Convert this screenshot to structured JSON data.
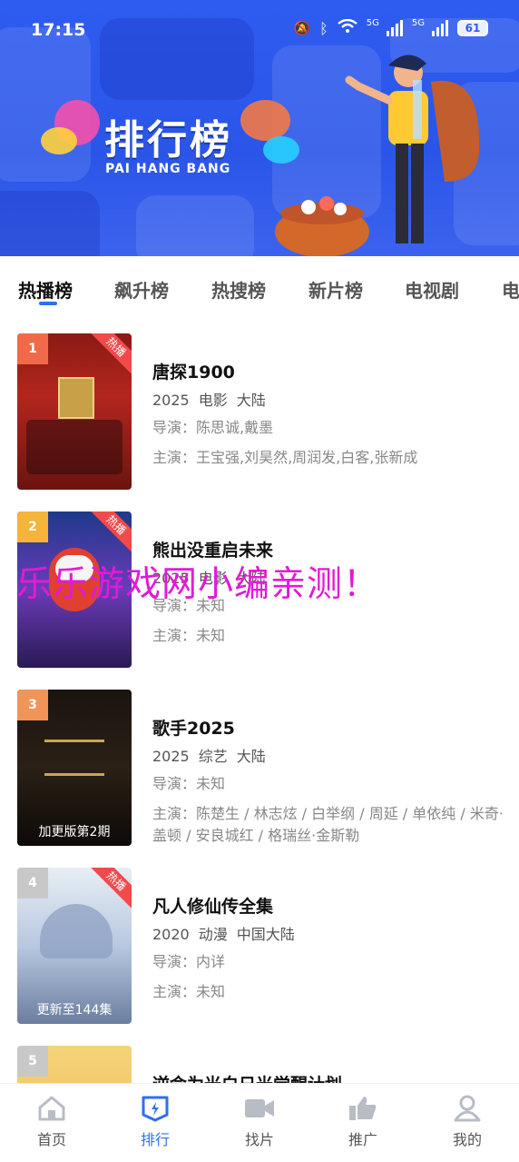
{
  "status_bar": {
    "time": "17:15",
    "network1": "5G",
    "network2": "5G",
    "battery": "61"
  },
  "banner": {
    "title": "排行榜",
    "subtitle": "PAI HANG BANG"
  },
  "tabs": [
    {
      "label": "热播榜",
      "active": true
    },
    {
      "label": "飙升榜"
    },
    {
      "label": "热搜榜"
    },
    {
      "label": "新片榜"
    },
    {
      "label": "电视剧"
    },
    {
      "label": "电"
    }
  ],
  "items": [
    {
      "rank": "1",
      "badge": "热播",
      "title": "唐探1900",
      "year": "2025",
      "genre": "电影",
      "region": "大陆",
      "director": "导演：陈思诚,戴墨",
      "cast": "主演：王宝强,刘昊然,周润发,白客,张新成",
      "overlay": ""
    },
    {
      "rank": "2",
      "badge": "热播",
      "title": "熊出没重启未来",
      "year": "2025",
      "genre": "电影",
      "region": "大陆",
      "director": "导演：未知",
      "cast": "主演：未知",
      "overlay": ""
    },
    {
      "rank": "3",
      "badge": "",
      "title": "歌手2025",
      "year": "2025",
      "genre": "综艺",
      "region": "大陆",
      "director": "导演：未知",
      "cast": "主演：陈楚生 / 林志炫 / 白举纲 / 周延 / 单依纯 / 米奇·盖顿 / 安良城红 / 格瑞丝·金斯勒",
      "overlay": "加更版第2期"
    },
    {
      "rank": "4",
      "badge": "热播",
      "title": "凡人修仙传全集",
      "year": "2020",
      "genre": "动漫",
      "region": "中国大陆",
      "director": "导演：内详",
      "cast": "主演：未知",
      "overlay": "更新至144集"
    },
    {
      "rank": "5",
      "badge": "",
      "title": "逆命为光白日光觉醒计划",
      "year": "",
      "genre": "",
      "region": "",
      "director": "",
      "cast": "",
      "overlay": ""
    }
  ],
  "watermark": "乐乐游戏网小编亲测！",
  "colors": {
    "accent": "#2f6ff0",
    "banner": "#2f5cf0",
    "hot_badge": "#f04a4a"
  },
  "bottom_nav": [
    {
      "label": "首页",
      "icon": "home-icon"
    },
    {
      "label": "排行",
      "icon": "ranking-icon",
      "active": true
    },
    {
      "label": "找片",
      "icon": "video-camera-icon"
    },
    {
      "label": "推广",
      "icon": "thumbs-up-icon"
    },
    {
      "label": "我的",
      "icon": "user-icon"
    }
  ]
}
